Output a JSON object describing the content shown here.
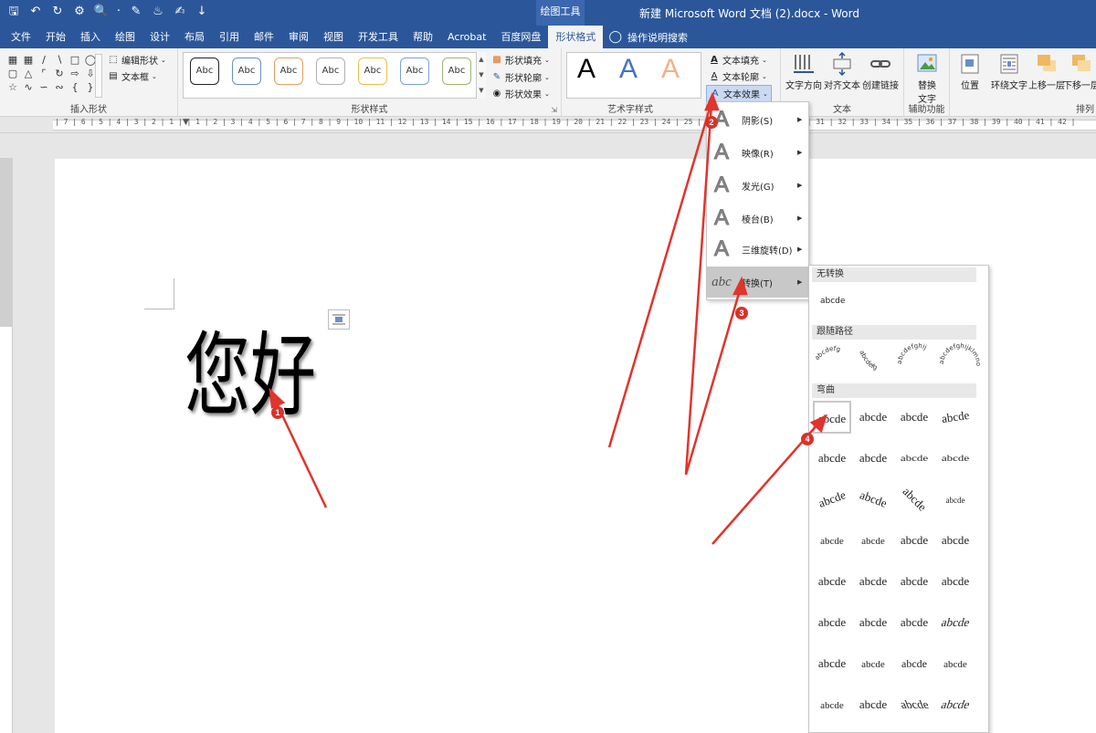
{
  "titlebar": {
    "context_tab": "绘图工具",
    "doc_title": "新建 Microsoft Word 文档 (2).docx  -  Word"
  },
  "tabs": [
    "文件",
    "开始",
    "插入",
    "绘图",
    "设计",
    "布局",
    "引用",
    "邮件",
    "审阅",
    "视图",
    "开发工具",
    "帮助",
    "Acrobat",
    "百度网盘",
    "形状格式"
  ],
  "active_tab": "形状格式",
  "tell_me": "操作说明搜索",
  "ribbon": {
    "insert_shapes": {
      "label": "插入形状",
      "edit_shape": "编辑形状",
      "text_box": "文本框"
    },
    "shape_styles": {
      "label": "形状样式",
      "sample_text": "Abc",
      "fill": "形状填充",
      "outline": "形状轮廓",
      "effects": "形状效果"
    },
    "wordart_styles": {
      "label": "艺术字样式",
      "sample": "A",
      "text_fill": "文本填充",
      "text_outline": "文本轮廓",
      "text_effects": "文本效果"
    },
    "text": {
      "label": "文本",
      "direction": "文字方向",
      "align": "对齐文本",
      "link": "创建链接"
    },
    "accessibility": {
      "label": "辅助功能",
      "alt_text_line1": "替换",
      "alt_text_line2": "文字"
    },
    "arrange": {
      "label": "排列",
      "position": "位置",
      "wrap": "环绕文字",
      "forward": "上移一层",
      "backward": "下移一层"
    }
  },
  "ruler_ticks": "| 7 | 6 | 5 | 4 | 3 | 2 | 1 |   | 1 | 2 | 3 | 4 | 5 | 6 | 7 | 8 | 9 | 10 | 11 | 12 | 13 | 14 | 15 | 16 | 17 | 18 | 19 | 20 | 21 | 22 | 23 | 24 | 25 | 26 | 27 | 28 | 29 | 30 | 31 | 32 | 33 | 34 | 35 | 36 | 37 | 38 | 39 | 40 | 41 | 42 |",
  "document": {
    "text": "您好"
  },
  "effects_menu": [
    {
      "label": "阴影(S)",
      "icon": "A"
    },
    {
      "label": "映像(R)",
      "icon": "A"
    },
    {
      "label": "发光(G)",
      "icon": "A"
    },
    {
      "label": "棱台(B)",
      "icon": "A"
    },
    {
      "label": "三维旋转(D)",
      "icon": "A"
    },
    {
      "label": "转换(T)",
      "icon": "abc"
    }
  ],
  "transform_panel": {
    "no_transform": "无转换",
    "no_transform_sample": "abcde",
    "follow_path": "跟随路径",
    "path_samples": [
      "abcdefg",
      "abcdefg",
      "abcdefghij",
      "abcdefghijklmnop"
    ],
    "warp": "弯曲",
    "sample": "abcde"
  },
  "annotations": [
    "1",
    "2",
    "3",
    "4"
  ],
  "colors": {
    "title_blue": "#2b579a",
    "arrow_red": "#d9322a"
  }
}
